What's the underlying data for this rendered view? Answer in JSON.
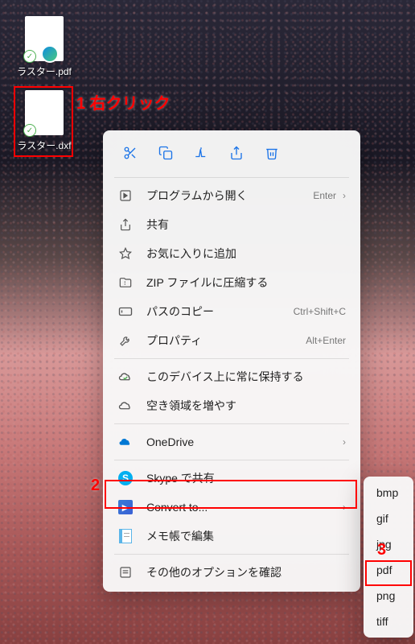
{
  "desktop_icons": {
    "pdf": {
      "label": "ラスター.pdf"
    },
    "dxf": {
      "label": "ラスター.dxf"
    }
  },
  "annotations": {
    "a1": "1 右クリック",
    "a2": "2",
    "a3": "3"
  },
  "toolbar": {
    "cut": "✂",
    "copy": "⧉",
    "rename": "AÍ",
    "share": "➦",
    "delete": "🗑"
  },
  "menu": {
    "open_with": {
      "label": "プログラムから開く",
      "shortcut": "Enter"
    },
    "share": {
      "label": "共有"
    },
    "favorite": {
      "label": "お気に入りに追加"
    },
    "zip": {
      "label": "ZIP ファイルに圧縮する"
    },
    "copy_path": {
      "label": "パスのコピー",
      "shortcut": "Ctrl+Shift+C"
    },
    "properties": {
      "label": "プロパティ",
      "shortcut": "Alt+Enter"
    },
    "keep_device": {
      "label": "このデバイス上に常に保持する"
    },
    "free_space": {
      "label": "空き領域を増やす"
    },
    "onedrive": {
      "label": "OneDrive"
    },
    "skype": {
      "label": "Skype で共有"
    },
    "convert": {
      "label": "Convert to..."
    },
    "notepad": {
      "label": "メモ帳で編集"
    },
    "more": {
      "label": "その他のオプションを確認"
    }
  },
  "submenu": {
    "bmp": "bmp",
    "gif": "gif",
    "jpg": "jpg",
    "pdf": "pdf",
    "png": "png",
    "tiff": "tiff"
  }
}
